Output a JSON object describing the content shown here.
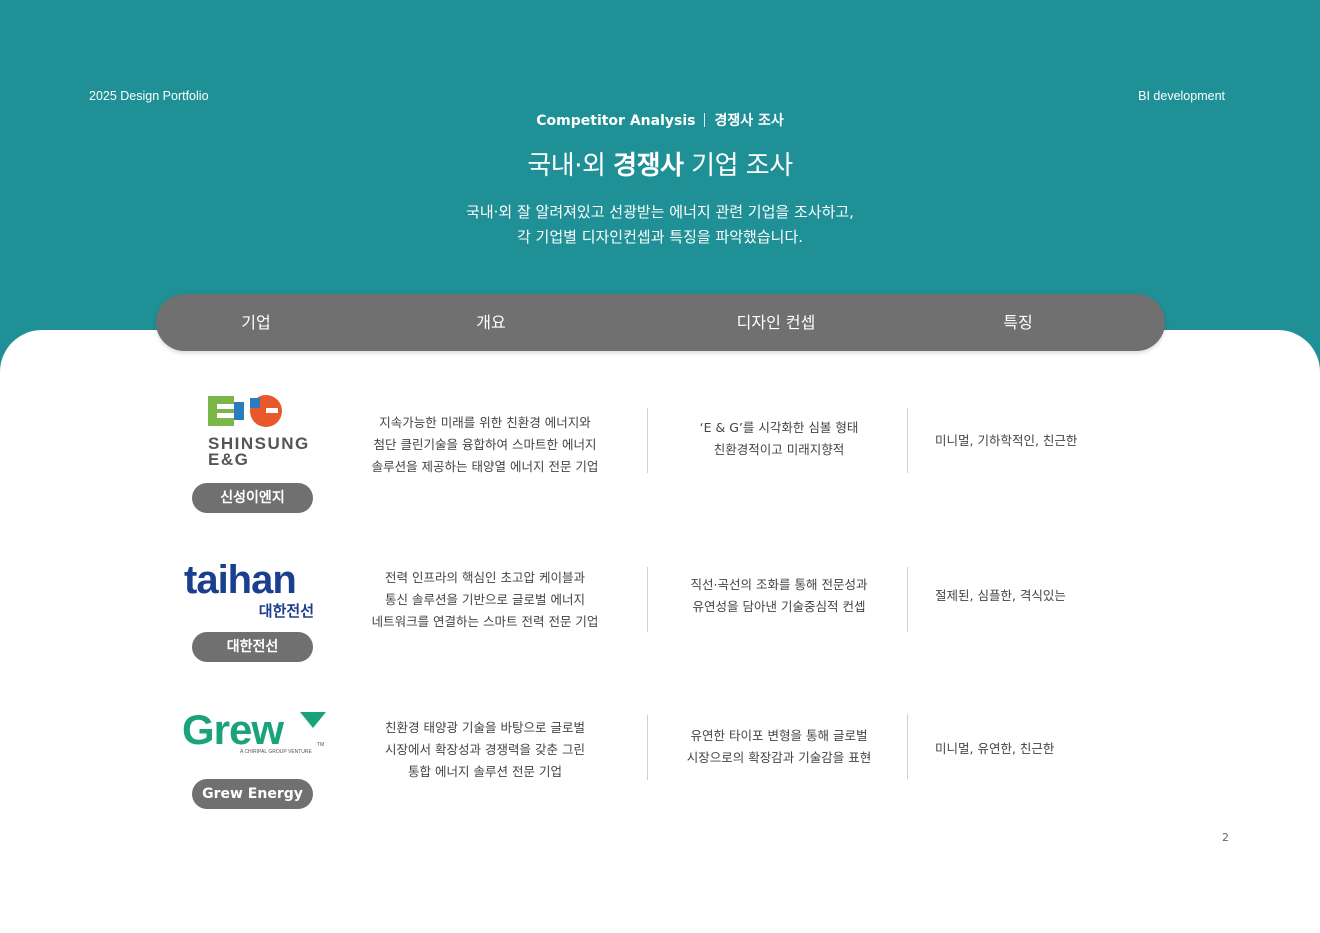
{
  "header": {
    "left": "2025 Design Portfolio",
    "right": "BI development",
    "kicker_en": "Competitor Analysis",
    "kicker_ko": "경쟁사 조사",
    "title_a": "국내·외 ",
    "title_b": "경쟁사",
    "title_c": " 기업 조사",
    "desc_line1": "국내·외 잘 알려져있고 선광받는 에너지 관련 기업을 조사하고,",
    "desc_line2": "각 기업별 디자인컨셉과 특징을 파악했습니다."
  },
  "table": {
    "headers": [
      "기업",
      "개요",
      "디자인 컨셉",
      "특징"
    ],
    "rows": [
      {
        "name": "신성이엔지",
        "logo_text_1": "SHINSUNG",
        "logo_text_2": "E&G",
        "overview": [
          "지속가능한 미래를 위한 친환경 에너지와",
          "첨단 클린기술을 융합하여 스마트한 에너지",
          "솔루션을 제공하는 태양열 에너지 전문 기업"
        ],
        "concept": [
          "‘E & G’를 시각화한 심볼 형태",
          "친환경적이고 미래지향적"
        ],
        "feature": "미니멀, 기하학적인, 친근한"
      },
      {
        "name": "대한전선",
        "logo_text_1": "taihan",
        "logo_text_2": "대한전선",
        "overview": [
          "전력 인프라의 핵심인 초고압 케이블과",
          "통신 솔루션을 기반으로 글로벌 에너지",
          "네트워크를 연결하는 스마트 전력 전문 기업"
        ],
        "concept": [
          "직선·곡선의 조화를 통해 전문성과",
          "유연성을 담아낸 기술중심적 컨셉"
        ],
        "feature": "절제된, 심플한, 격식있는"
      },
      {
        "name": "Grew Energy",
        "logo_text_1": "Grew",
        "logo_text_2": "A CHIRIPAL GROUP VENTURE",
        "logo_tm": "TM",
        "overview": [
          "친환경 태양광 기술을 바탕으로 글로벌",
          "시장에서 확장성과 경쟁력을 갖춘 그린",
          "통합 에너지 솔루션 전문 기업"
        ],
        "concept": [
          "유연한 타이포 변형을 통해 글로벌",
          "시장으로의 확장감과 기술감을 표현"
        ],
        "feature": "미니멀, 유연한, 친근한"
      }
    ]
  },
  "page_number": "2",
  "colors": {
    "teal": "#1e9096",
    "gray": "#707070",
    "eg_green": "#7ab648",
    "eg_blue": "#2a7bbf",
    "eg_orange": "#e8582a",
    "taihan_blue": "#1b3f8f",
    "grew_green": "#1aa37a"
  }
}
